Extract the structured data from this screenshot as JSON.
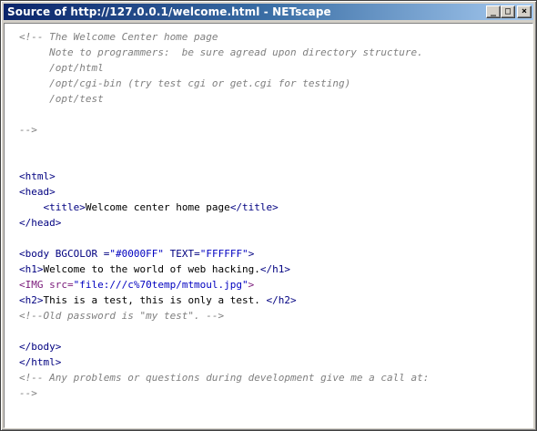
{
  "window": {
    "title": "Source of http://127.0.0.1/welcome.html - NETscape",
    "minimize": "_",
    "maximize": "□",
    "close": "×"
  },
  "source_lines": [
    {
      "parts": [
        {
          "t": "<!-- The Welcome Center home page",
          "c": "cmt"
        }
      ]
    },
    {
      "parts": [
        {
          "t": "     Note to programmers:  be sure agread upon directory structure.",
          "c": "cmt"
        }
      ]
    },
    {
      "parts": [
        {
          "t": "     /opt/html",
          "c": "cmt"
        }
      ]
    },
    {
      "parts": [
        {
          "t": "     /opt/cgi-bin (try test cgi or get.cgi for testing)",
          "c": "cmt"
        }
      ]
    },
    {
      "parts": [
        {
          "t": "     /opt/test",
          "c": "cmt"
        }
      ]
    },
    {
      "parts": []
    },
    {
      "parts": [
        {
          "t": "-->",
          "c": "cmt"
        }
      ]
    },
    {
      "parts": []
    },
    {
      "parts": []
    },
    {
      "parts": [
        {
          "t": "<html>",
          "c": "tag"
        }
      ]
    },
    {
      "parts": [
        {
          "t": "<head>",
          "c": "tag"
        }
      ]
    },
    {
      "parts": [
        {
          "t": "    ",
          "c": ""
        },
        {
          "t": "<title>",
          "c": "tag"
        },
        {
          "t": "Welcome center home page",
          "c": ""
        },
        {
          "t": "</title>",
          "c": "tag"
        }
      ]
    },
    {
      "parts": [
        {
          "t": "</head>",
          "c": "tag"
        }
      ]
    },
    {
      "parts": []
    },
    {
      "parts": [
        {
          "t": "<body BGCOLOR =",
          "c": "tag"
        },
        {
          "t": "\"#0000FF\"",
          "c": "val"
        },
        {
          "t": " TEXT=",
          "c": "tag"
        },
        {
          "t": "\"FFFFFF\"",
          "c": "val"
        },
        {
          "t": ">",
          "c": "tag"
        }
      ]
    },
    {
      "parts": [
        {
          "t": "<h1>",
          "c": "tag"
        },
        {
          "t": "Welcome to the world of web hacking.",
          "c": ""
        },
        {
          "t": "</h1>",
          "c": "tag"
        }
      ]
    },
    {
      "parts": [
        {
          "t": "<IMG src=",
          "c": "img"
        },
        {
          "t": "\"file:///c%70temp/mtmoul.jpg\"",
          "c": "val"
        },
        {
          "t": ">",
          "c": "img"
        }
      ]
    },
    {
      "parts": [
        {
          "t": "<h2>",
          "c": "tag"
        },
        {
          "t": "This is a test, this is only a test. ",
          "c": ""
        },
        {
          "t": "</h2>",
          "c": "tag"
        }
      ]
    },
    {
      "parts": [
        {
          "t": "<!--Old password is \"my test\". -->",
          "c": "cmt"
        }
      ]
    },
    {
      "parts": []
    },
    {
      "parts": [
        {
          "t": "</body>",
          "c": "tag"
        }
      ]
    },
    {
      "parts": [
        {
          "t": "</html>",
          "c": "tag"
        }
      ]
    },
    {
      "parts": [
        {
          "t": "<!-- Any problems or questions during development give me a call at:",
          "c": "cmt"
        }
      ]
    },
    {
      "parts": [
        {
          "t": "-->",
          "c": "cmt"
        }
      ]
    }
  ]
}
